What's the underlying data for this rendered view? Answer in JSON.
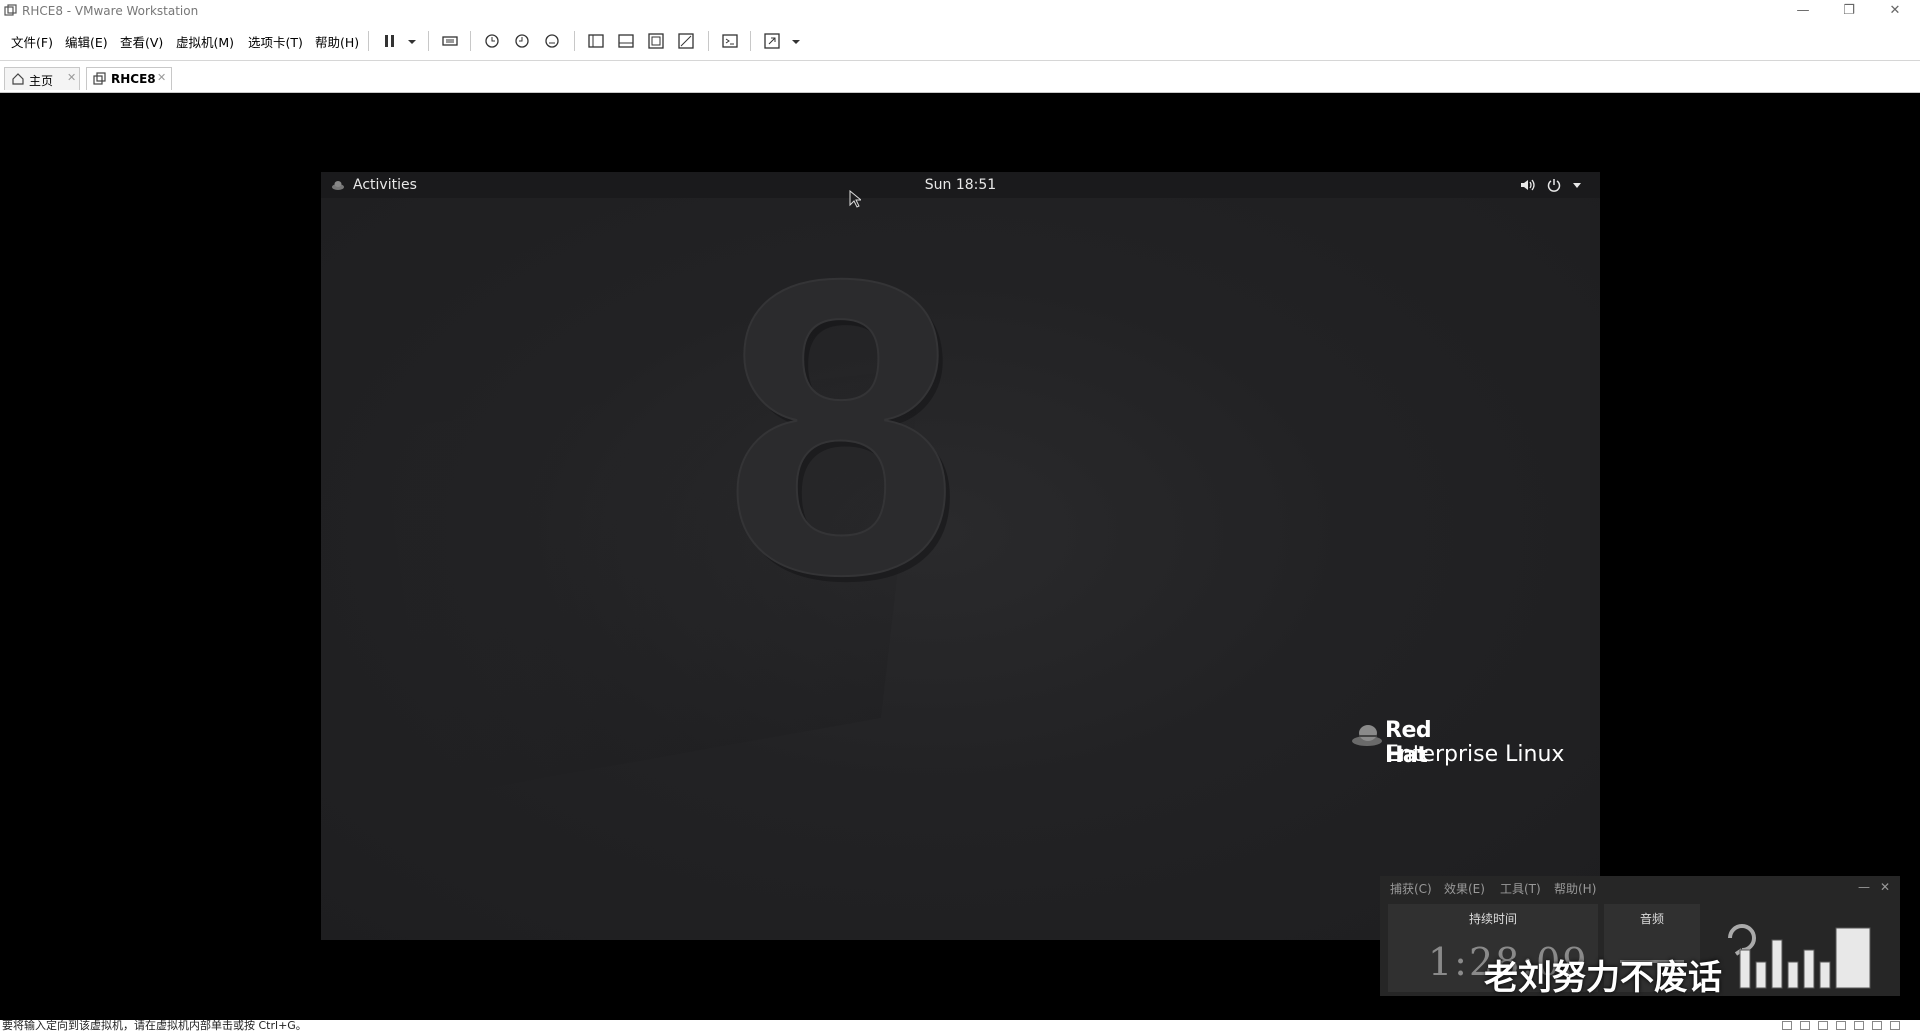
{
  "window": {
    "title": "RHCE8 - VMware Workstation",
    "minimize": "—",
    "restore": "❐",
    "close": "✕"
  },
  "menu": {
    "items": [
      "文件(F)",
      "编辑(E)",
      "查看(V)",
      "虚拟机(M)",
      "选项卡(T)",
      "帮助(H)"
    ]
  },
  "toolbar": {
    "icons": [
      "pause-icon",
      "dropdown-arrow-icon",
      "send-ctrl-alt-del-icon",
      "snapshot-icon",
      "revert-snapshot-icon",
      "snapshot-manager-icon",
      "library-view-icon",
      "thumbnail-bar-icon",
      "full-screen-icon",
      "unity-icon",
      "console-view-icon",
      "stretch-guest-icon"
    ]
  },
  "tabs": [
    {
      "label": "主页",
      "icon": "home-icon",
      "close": "✕"
    },
    {
      "label": "RHCE8",
      "icon": "vm-icon",
      "close": "✕"
    }
  ],
  "guest": {
    "activities": "Activities",
    "clock": "Sun 18:51",
    "wallpaper_number": "8",
    "brand_line1": "Red Hat",
    "brand_line2": "Enterprise Linux"
  },
  "recorder": {
    "menu": [
      "捕获(C)",
      "效果(E)",
      "工具(T)",
      "帮助(H)"
    ],
    "duration_label": "持续时间",
    "duration_value": "1:28:09",
    "audio_label": "音频",
    "minimize": "—",
    "close": "✕"
  },
  "overlay": {
    "watermark": "老刘努力不废话"
  },
  "statusbar": {
    "message": "要将输入定向到该虚拟机，请在虚拟机内部单击或按 Ctrl+G。"
  },
  "colors": {
    "vm_background": "#000000",
    "guest_panel": "#1a1a1c",
    "wallpaper": "#1e1e20",
    "brand_text": "#ffffff"
  }
}
